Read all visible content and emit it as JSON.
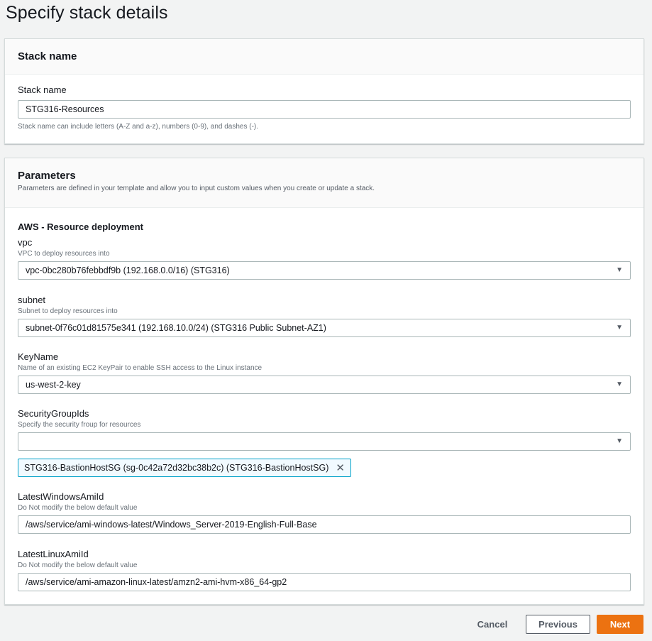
{
  "page": {
    "title": "Specify stack details"
  },
  "stack_panel": {
    "header": "Stack name",
    "label": "Stack name",
    "value": "STG316-Resources",
    "hint": "Stack name can include letters (A-Z and a-z), numbers (0-9), and dashes (-)."
  },
  "params_panel": {
    "header": "Parameters",
    "description": "Parameters are defined in your template and allow you to input custom values when you create or update a stack.",
    "section": "AWS - Resource deployment",
    "vpc": {
      "label": "vpc",
      "desc": "VPC to deploy resources into",
      "value": "vpc-0bc280b76febbdf9b (192.168.0.0/16) (STG316)"
    },
    "subnet": {
      "label": "subnet",
      "desc": "Subnet to deploy resources into",
      "value": "subnet-0f76c01d81575e341 (192.168.10.0/24) (STG316 Public Subnet-AZ1)"
    },
    "keyname": {
      "label": "KeyName",
      "desc": "Name of an existing EC2 KeyPair to enable SSH access to the Linux instance",
      "value": "us-west-2-key"
    },
    "sg": {
      "label": "SecurityGroupIds",
      "desc": "Specify the security froup for resources",
      "value": "",
      "token": "STG316-BastionHostSG (sg-0c42a72d32bc38b2c) (STG316-BastionHostSG)"
    },
    "win_ami": {
      "label": "LatestWindowsAmiId",
      "desc": "Do Not modify the below default value",
      "value": "/aws/service/ami-windows-latest/Windows_Server-2019-English-Full-Base"
    },
    "linux_ami": {
      "label": "LatestLinuxAmiId",
      "desc": "Do Not modify the below default value",
      "value": "/aws/service/ami-amazon-linux-latest/amzn2-ami-hvm-x86_64-gp2"
    }
  },
  "icons": {
    "dropdown": "caret-down-icon",
    "remove": "close-icon"
  },
  "buttons": {
    "cancel": "Cancel",
    "previous": "Previous",
    "next": "Next"
  },
  "colors": {
    "primary": "#ec7211",
    "token_border": "#00a1c9",
    "token_bg": "#f1faff"
  }
}
